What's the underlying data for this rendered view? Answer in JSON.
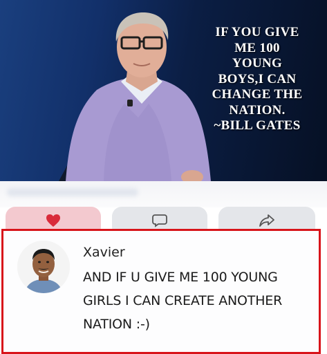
{
  "post": {
    "quote_text": "IF YOU GIVE\nME 100\nYOUNG\nBOYS,I CAN\nCHANGE THE\nNATION.\n~BILL GATES"
  },
  "actions": [
    {
      "name": "like",
      "icon": "heart-icon"
    },
    {
      "name": "comment",
      "icon": "comment-icon"
    },
    {
      "name": "share",
      "icon": "share-icon"
    }
  ],
  "comment": {
    "author": "Xavier",
    "text": "AND IF U GIVE ME 100 YOUNG\nGIRLS I CAN CREATE ANOTHER\nNATION :-)",
    "highlight_color": "#d8141a"
  }
}
